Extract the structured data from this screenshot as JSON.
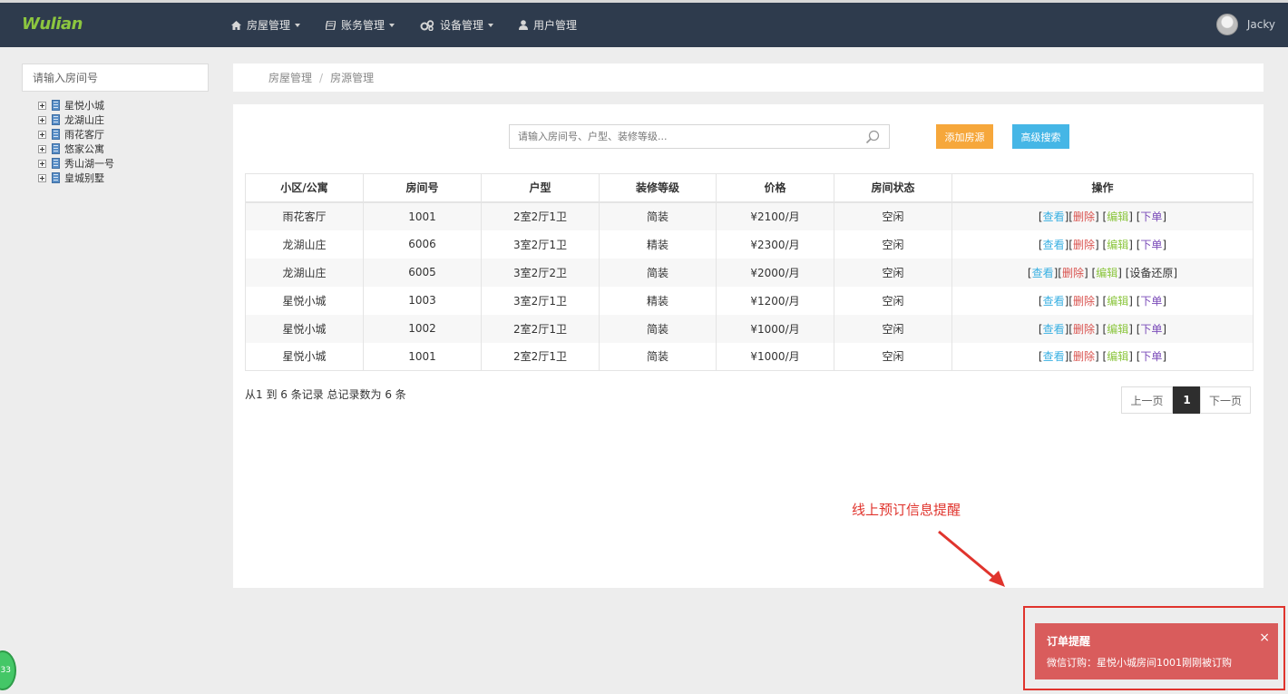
{
  "app": {
    "logo": "Wulian"
  },
  "nav": [
    {
      "label": "房屋管理",
      "icon": "home-icon",
      "dropdown": true
    },
    {
      "label": "账务管理",
      "icon": "book-icon",
      "dropdown": true
    },
    {
      "label": "设备管理",
      "icon": "cogs-icon",
      "dropdown": true
    },
    {
      "label": "用户管理",
      "icon": "user-icon",
      "dropdown": false
    }
  ],
  "user": {
    "name": "Jacky"
  },
  "sidebar": {
    "search_placeholder": "请输入房间号",
    "tree": [
      "星悦小城",
      "龙湖山庄",
      "雨花客厅",
      "悠家公寓",
      "秀山湖一号",
      "皇城别墅"
    ]
  },
  "breadcrumb": {
    "parent": "房屋管理",
    "separator": "/",
    "current": "房源管理"
  },
  "toolbar": {
    "search_placeholder": "请输入房间号、户型、装修等级...",
    "add_label": "添加房源",
    "advanced_label": "高级搜索"
  },
  "table": {
    "headers": [
      "小区/公寓",
      "房间号",
      "户型",
      "装修等级",
      "价格",
      "房间状态",
      "操作"
    ],
    "rows": [
      {
        "community": "雨花客厅",
        "room": "1001",
        "layout": "2室2厅1卫",
        "decor": "简装",
        "price": "¥2100/月",
        "status": "空闲",
        "last_op": "下单"
      },
      {
        "community": "龙湖山庄",
        "room": "6006",
        "layout": "3室2厅1卫",
        "decor": "精装",
        "price": "¥2300/月",
        "status": "空闲",
        "last_op": "下单"
      },
      {
        "community": "龙湖山庄",
        "room": "6005",
        "layout": "3室2厅2卫",
        "decor": "简装",
        "price": "¥2000/月",
        "status": "空闲",
        "last_op": "设备还原"
      },
      {
        "community": "星悦小城",
        "room": "1003",
        "layout": "3室2厅1卫",
        "decor": "精装",
        "price": "¥1200/月",
        "status": "空闲",
        "last_op": "下单"
      },
      {
        "community": "星悦小城",
        "room": "1002",
        "layout": "2室2厅1卫",
        "decor": "简装",
        "price": "¥1000/月",
        "status": "空闲",
        "last_op": "下单"
      },
      {
        "community": "星悦小城",
        "room": "1001",
        "layout": "2室2厅1卫",
        "decor": "简装",
        "price": "¥1000/月",
        "status": "空闲",
        "last_op": "下单"
      }
    ],
    "ops": {
      "view": "查看",
      "delete": "删除",
      "edit": "编辑"
    }
  },
  "footer": {
    "record_info": "从1 到 6 条记录 总记录数为 6 条",
    "pager": {
      "prev": "上一页",
      "current": "1",
      "next": "下一页"
    }
  },
  "annotation": {
    "text": "线上预订信息提醒",
    "color": "#e0342d"
  },
  "toast": {
    "title": "订单提醒",
    "message": "微信订购：星悦小城房间1001刚刚被订购",
    "close": "×"
  },
  "badge": {
    "text": "33"
  },
  "colors": {
    "navbar": "#2e3b4d",
    "logo": "#8cc63f",
    "add_button": "#f6a73b",
    "advanced_button": "#45b6e6",
    "toast": "#d95c5c",
    "view_link": "#3ab0e2",
    "delete_link": "#d9534f",
    "edit_link": "#8cc63f",
    "order_link": "#7a4bb8"
  }
}
